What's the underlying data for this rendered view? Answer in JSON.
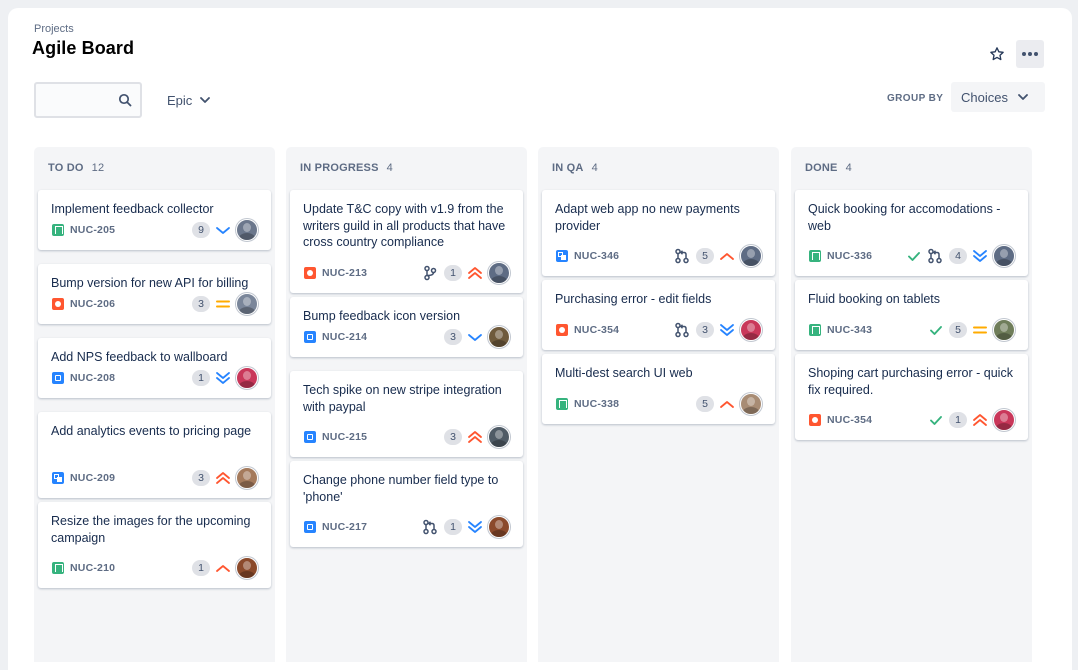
{
  "header": {
    "breadcrumb": "Projects",
    "title": "Agile Board"
  },
  "toolbar": {
    "search_placeholder": "",
    "epic_label": "Epic",
    "group_by_label": "GROUP BY",
    "group_by_value": "Choices"
  },
  "colors": {
    "story": "#36b37e",
    "bug": "#ff5630",
    "task": "#2684ff",
    "priority_high": "#ff5630",
    "priority_medium": "#ffab00",
    "priority_low": "#2684ff",
    "done_check": "#36b37e"
  },
  "columns": [
    {
      "name": "TO DO",
      "count": "12",
      "cards": [
        {
          "title": "Implement feedback collector",
          "type": "story",
          "key": "NUC-205",
          "points": "9",
          "priority": "low",
          "avatar": "#6b778c"
        },
        {
          "title": "Bump version for new API for billing",
          "type": "bug",
          "key": "NUC-206",
          "points": "3",
          "priority": "medium",
          "avatar": "#7a869a"
        },
        {
          "title": "Add NPS feedback to wallboard",
          "type": "task",
          "key": "NUC-208",
          "points": "1",
          "priority": "lowest",
          "avatar": "#c9375a"
        },
        {
          "title": "Add analytics events to pricing page",
          "type": "subtask",
          "key": "NUC-209",
          "points": "3",
          "priority": "highest",
          "avatar": "#a47a5c"
        },
        {
          "title": "Resize the images for the upcoming campaign",
          "type": "story",
          "key": "NUC-210",
          "points": "1",
          "priority": "high",
          "avatar": "#8b4a2b"
        }
      ]
    },
    {
      "name": "IN PROGRESS",
      "count": "4",
      "cards": [
        {
          "title": "Update T&C copy with v1.9 from the writers guild in all products that have cross country compliance",
          "type": "bug",
          "key": "NUC-213",
          "branch": true,
          "points": "1",
          "priority": "highest",
          "avatar": "#5e6c84"
        },
        {
          "title": "Bump feedback icon version",
          "type": "task",
          "key": "NUC-214",
          "points": "3",
          "priority": "low",
          "avatar": "#6f5a3c"
        },
        {
          "title": "Tech spike on new stripe integration with paypal",
          "type": "task",
          "key": "NUC-215",
          "points": "3",
          "priority": "highest",
          "avatar": "#4f5b66"
        },
        {
          "title": "Change phone number field type to 'phone'",
          "type": "task",
          "key": "NUC-217",
          "pr": true,
          "points": "1",
          "priority": "lowest",
          "avatar": "#8b4a2b"
        }
      ]
    },
    {
      "name": "IN QA",
      "count": "4",
      "cards": [
        {
          "title": "Adapt web app no new payments provider",
          "type": "subtask",
          "key": "NUC-346",
          "pr": true,
          "points": "5",
          "priority": "high",
          "avatar": "#5e6c84"
        },
        {
          "title": "Purchasing error - edit fields",
          "type": "bug",
          "key": "NUC-354",
          "pr": true,
          "points": "3",
          "priority": "lowest",
          "avatar": "#c9375a"
        },
        {
          "title": "Multi-dest search UI web",
          "type": "story",
          "key": "NUC-338",
          "points": "5",
          "priority": "high",
          "avatar": "#a88c74"
        }
      ]
    },
    {
      "name": "DONE",
      "count": "4",
      "cards": [
        {
          "title": "Quick booking for accomodations - web",
          "type": "story",
          "key": "NUC-336",
          "check": true,
          "pr": true,
          "points": "4",
          "priority": "lowest",
          "avatar": "#5e6c84"
        },
        {
          "title": "Fluid booking on tablets",
          "type": "story",
          "key": "NUC-343",
          "check": true,
          "points": "5",
          "priority": "medium",
          "avatar": "#6f7d5a"
        },
        {
          "title": "Shoping cart purchasing error - quick fix required.",
          "type": "bug",
          "key": "NUC-354",
          "check": true,
          "points": "1",
          "priority": "highest",
          "avatar": "#c9375a"
        }
      ]
    }
  ]
}
